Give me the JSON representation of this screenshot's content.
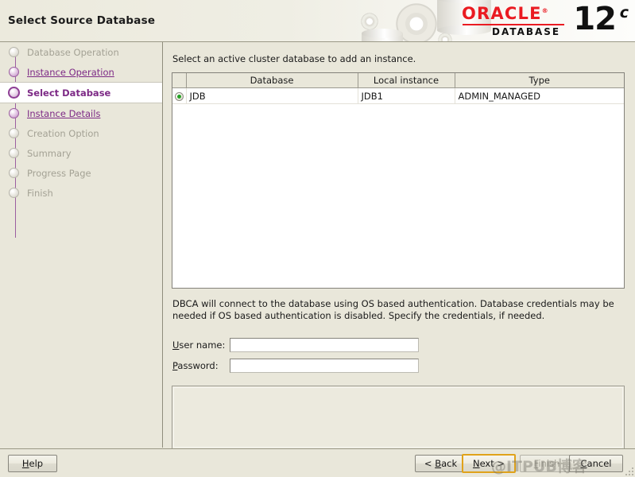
{
  "header": {
    "title": "Select Source Database",
    "brand": {
      "name": "ORACLE",
      "trademark": "®",
      "product": "DATABASE",
      "version": "12",
      "edition": "c"
    }
  },
  "sidebar": {
    "steps": [
      {
        "label": "Database Operation",
        "state": "pending"
      },
      {
        "label": "Instance Operation",
        "state": "done"
      },
      {
        "label": "Select Database",
        "state": "active"
      },
      {
        "label": "Instance Details",
        "state": "done"
      },
      {
        "label": "Creation Option",
        "state": "pending"
      },
      {
        "label": "Summary",
        "state": "pending"
      },
      {
        "label": "Progress Page",
        "state": "pending"
      },
      {
        "label": "Finish",
        "state": "pending"
      }
    ]
  },
  "main": {
    "instruction": "Select an active cluster database to add an instance.",
    "table": {
      "columns": [
        "Database",
        "Local instance",
        "Type"
      ],
      "rows": [
        {
          "selected": true,
          "database": "JDB",
          "local_instance": "JDB1",
          "type": "ADMIN_MANAGED"
        }
      ]
    },
    "credentials": {
      "note": "DBCA will connect to the database using OS based authentication. Database credentials may be needed if OS based authentication is disabled. Specify the credentials, if needed.",
      "username_label": "User name:",
      "username_mnemonic": "U",
      "username_label_rest": "ser name:",
      "username_value": "",
      "password_label": "Password:",
      "password_mnemonic": "P",
      "password_label_rest": "assword:",
      "password_value": ""
    }
  },
  "footer": {
    "help": {
      "mnemonic": "H",
      "rest": "elp"
    },
    "back": {
      "prefix": "< ",
      "mnemonic": "B",
      "rest": "ack"
    },
    "next": {
      "mnemonic": "N",
      "rest": "ext >"
    },
    "finish": {
      "mnemonic": "F",
      "rest": "inish"
    },
    "cancel": {
      "mnemonic": "C",
      "rest": "ancel"
    }
  },
  "watermark": "@ITPUB博客"
}
